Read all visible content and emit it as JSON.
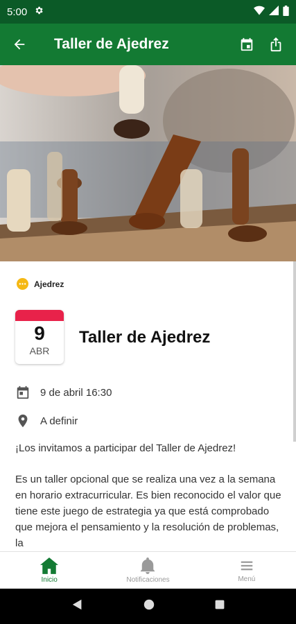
{
  "status": {
    "time": "5:00"
  },
  "appbar": {
    "title": "Taller de Ajedrez"
  },
  "category": {
    "label": "Ajedrez"
  },
  "date": {
    "day": "9",
    "month": "ABR"
  },
  "event": {
    "title": "Taller de Ajedrez",
    "datetime": "9 de abril 16:30",
    "location": "A definir"
  },
  "description": {
    "p1": "¡Los invitamos a participar del Taller de Ajedrez!",
    "p2": "Es un taller opcional que se realiza una vez a la semana en horario extracurricular. Es bien reconocido el valor que tiene este juego de estrategia ya que está comprobado que mejora el pensamiento y la resolución de problemas, la"
  },
  "nav": {
    "home": "Inicio",
    "notifications": "Notificaciones",
    "menu": "Menú"
  },
  "colors": {
    "primary": "#137a33",
    "status": "#0b5a27",
    "accent": "#e8224a",
    "category": "#f5b814"
  }
}
